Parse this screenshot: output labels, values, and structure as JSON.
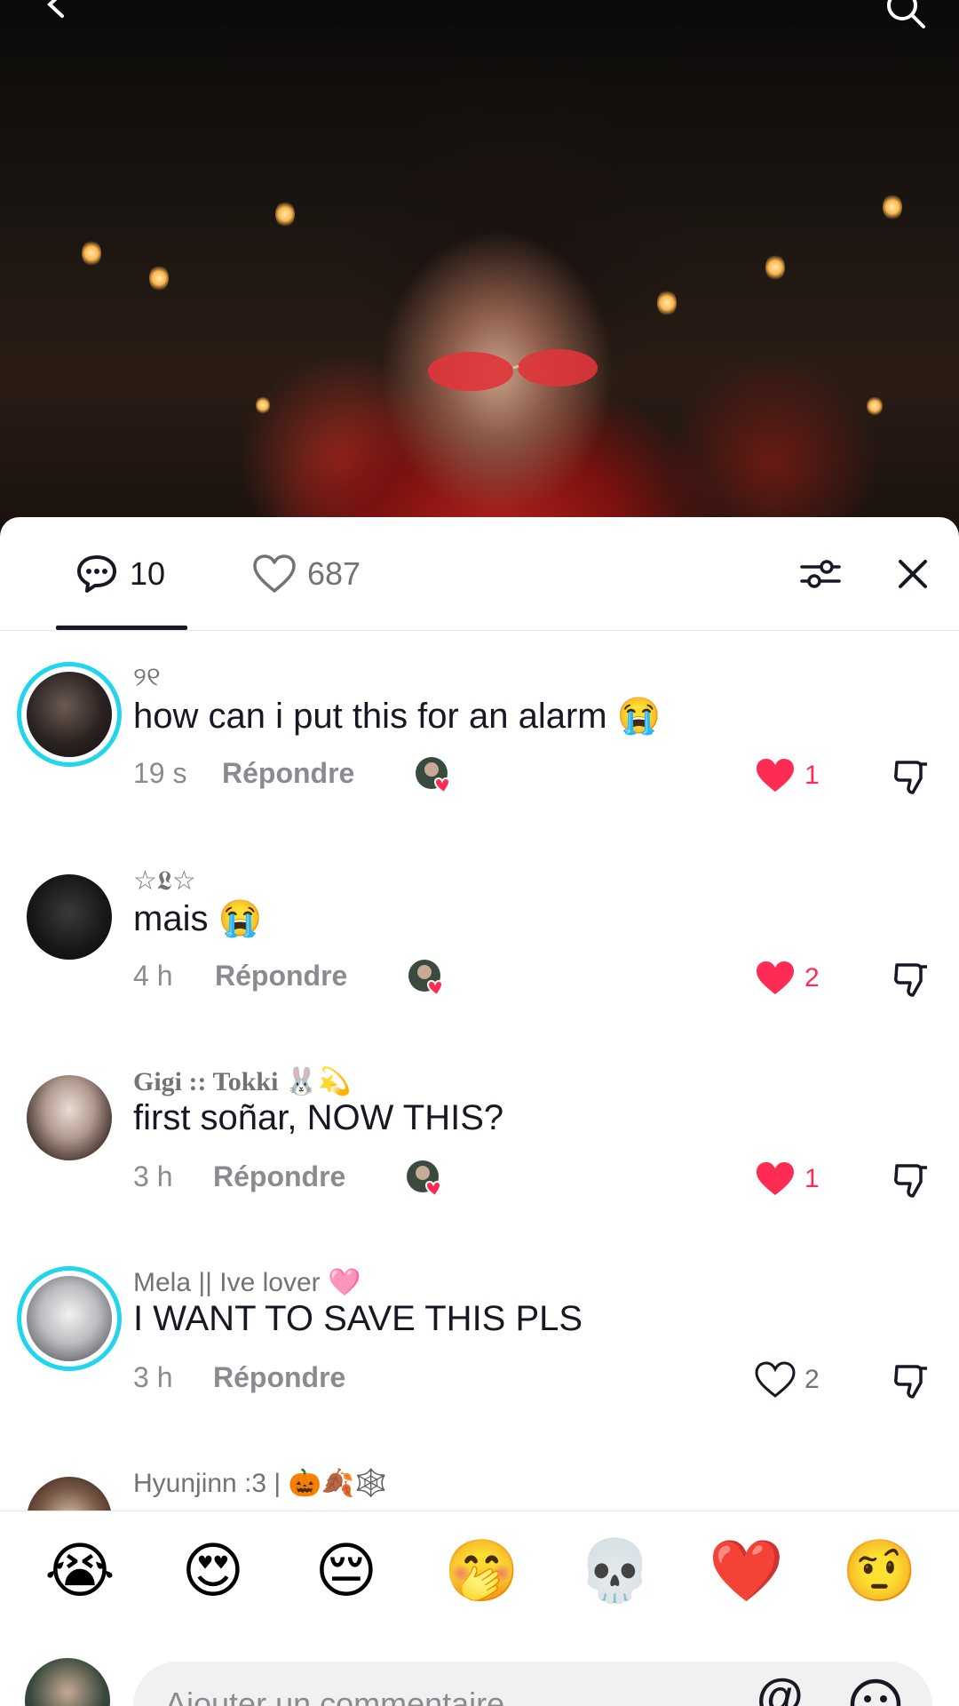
{
  "video": {
    "alt": "music video frame"
  },
  "header": {
    "comments_count": "10",
    "likes_count": "687"
  },
  "comments": [
    {
      "username": "୨୧",
      "text": "how can i put this for an alarm 😭",
      "time": "19 s",
      "reply_label": "Répondre",
      "likes": "1",
      "liked": true,
      "avatar_ring": true
    },
    {
      "username": "☆𝕷☆",
      "text": "mais 😭",
      "time": "4 h",
      "reply_label": "Répondre",
      "likes": "2",
      "liked": true,
      "avatar_ring": false
    },
    {
      "username": "Gigi :: Tokki 🐰💫",
      "text": "first soñar, NOW THIS?",
      "time": "3 h",
      "reply_label": "Répondre",
      "likes": "1",
      "liked": true,
      "avatar_ring": false
    },
    {
      "username": "Mela || Ive lover 🩷",
      "text": "I WANT TO SAVE THIS PLS",
      "time": "3 h",
      "reply_label": "Répondre",
      "likes": "2",
      "liked": false,
      "avatar_ring": true
    },
    {
      "username": "Hyunjinn :3 | 🎃🍂🕸️",
      "text": "",
      "time": "",
      "reply_label": "",
      "likes": "",
      "liked": false,
      "avatar_ring": false
    }
  ],
  "quick_emojis": [
    "😭",
    "😍",
    "😔",
    "🤭",
    "💀",
    "❤️",
    "🤨"
  ],
  "composer": {
    "placeholder": "Ajouter un commentaire...",
    "mention_label": "@"
  },
  "colors": {
    "accent_like": "#fe2c55",
    "story_ring": "#20d5ec",
    "text_primary": "#161823",
    "text_secondary": "#8a8b91"
  },
  "icons": {
    "back": "chevron-left-icon",
    "search": "search-icon",
    "comments": "comment-bubble-icon",
    "likes": "heart-outline-icon",
    "filter": "sliders-icon",
    "close": "close-icon",
    "like": "heart-icon",
    "dislike": "thumbs-down-icon",
    "emoji": "smiley-icon"
  }
}
